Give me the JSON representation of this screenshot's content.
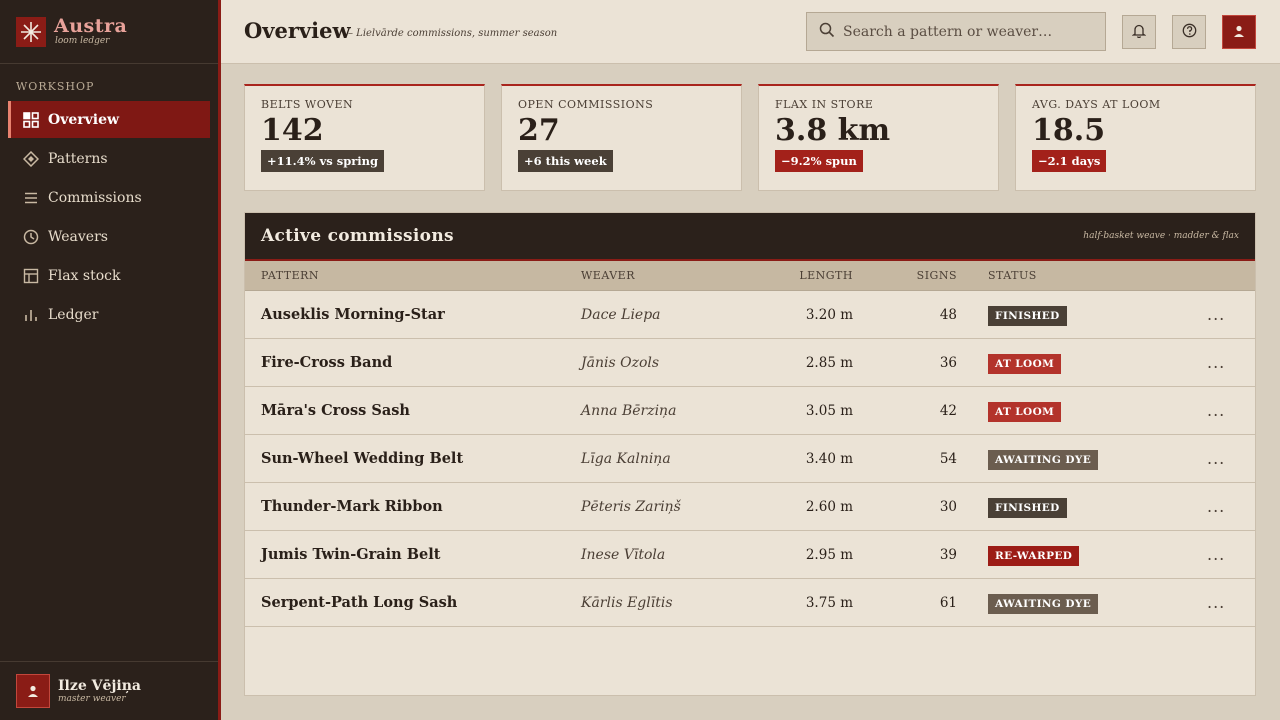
{
  "brand": {
    "name": "Austra",
    "subtitle": "loom ledger"
  },
  "sidebar": {
    "section_label": "WORKSHOP",
    "items": [
      {
        "label": "Overview",
        "icon": "grid-icon",
        "active": true
      },
      {
        "label": "Patterns",
        "icon": "diamond-icon",
        "active": false
      },
      {
        "label": "Commissions",
        "icon": "list-icon",
        "active": false
      },
      {
        "label": "Weavers",
        "icon": "clock-icon",
        "active": false
      },
      {
        "label": "Flax stock",
        "icon": "table-icon",
        "active": false
      },
      {
        "label": "Ledger",
        "icon": "bar-chart-icon",
        "active": false
      }
    ],
    "user": {
      "name": "Ilze Vējiņa",
      "role": "master weaver"
    }
  },
  "header": {
    "title": "Overview",
    "subtitle": "– Lielvārde commissions, summer season",
    "search_placeholder": "Search a pattern or weaver…"
  },
  "stats": [
    {
      "label": "BELTS WOVEN",
      "value": "142",
      "badge": "+11.4% vs spring",
      "trend": "up"
    },
    {
      "label": "OPEN COMMISSIONS",
      "value": "27",
      "badge": "+6 this week",
      "trend": "up"
    },
    {
      "label": "FLAX IN STORE",
      "value": "3.8 km",
      "badge": "−9.2% spun",
      "trend": "down"
    },
    {
      "label": "AVG. DAYS AT LOOM",
      "value": "18.5",
      "badge": "−2.1 days",
      "trend": "down"
    }
  ],
  "table": {
    "title": "Active commissions",
    "note": "half-basket weave · madder & flax",
    "columns": {
      "pattern": "PATTERN",
      "weaver": "WEAVER",
      "length": "LENGTH",
      "signs": "SIGNS",
      "status": "STATUS"
    },
    "rows": [
      {
        "pattern": "Auseklis Morning-Star",
        "weaver": "Dace Liepa",
        "length": "3.20 m",
        "signs": "48",
        "status": "FINISHED",
        "status_kind": "finished"
      },
      {
        "pattern": "Fire-Cross Band",
        "weaver": "Jānis Ozols",
        "length": "2.85 m",
        "signs": "36",
        "status": "AT LOOM",
        "status_kind": "loom"
      },
      {
        "pattern": "Māra's Cross Sash",
        "weaver": "Anna Bērziņa",
        "length": "3.05 m",
        "signs": "42",
        "status": "AT LOOM",
        "status_kind": "loom"
      },
      {
        "pattern": "Sun-Wheel Wedding Belt",
        "weaver": "Līga Kalniņa",
        "length": "3.40 m",
        "signs": "54",
        "status": "AWAITING DYE",
        "status_kind": "dye"
      },
      {
        "pattern": "Thunder-Mark Ribbon",
        "weaver": "Pēteris Zariņš",
        "length": "2.60 m",
        "signs": "30",
        "status": "FINISHED",
        "status_kind": "finished"
      },
      {
        "pattern": "Jumis Twin-Grain Belt",
        "weaver": "Inese Vītola",
        "length": "2.95 m",
        "signs": "39",
        "status": "RE-WARPED",
        "status_kind": "rewarped"
      },
      {
        "pattern": "Serpent-Path Long Sash",
        "weaver": "Kārlis Eglītis",
        "length": "3.75 m",
        "signs": "61",
        "status": "AWAITING DYE",
        "status_kind": "dye"
      }
    ],
    "more_label": "..."
  },
  "colors": {
    "accent": "#8a1c16",
    "sidebar_bg": "#2b211b",
    "panel_bg": "#ebe3d6"
  }
}
